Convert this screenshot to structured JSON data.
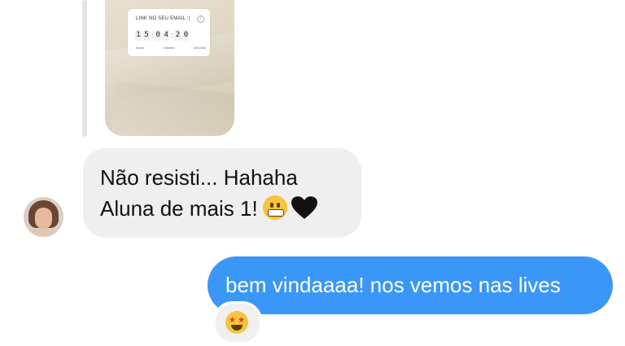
{
  "story": {
    "countdown_title": "LINK NO SEU EMAIL :)",
    "digits": [
      "1",
      "5",
      "0",
      "4",
      "2",
      "0"
    ],
    "units": [
      "hours",
      "minutes",
      "seconds"
    ]
  },
  "incoming_message": {
    "line1": "Não resisti... Hahaha",
    "line2": "Aluna de mais 1!",
    "emojis": [
      "grimacing-face",
      "black-heart"
    ],
    "bubble_color": "#efefef"
  },
  "outgoing_message": {
    "text": "bem vindaaaa! nos vemos nas lives",
    "bubble_color": "#3a97f7"
  },
  "reaction": {
    "emoji": "star-struck"
  }
}
